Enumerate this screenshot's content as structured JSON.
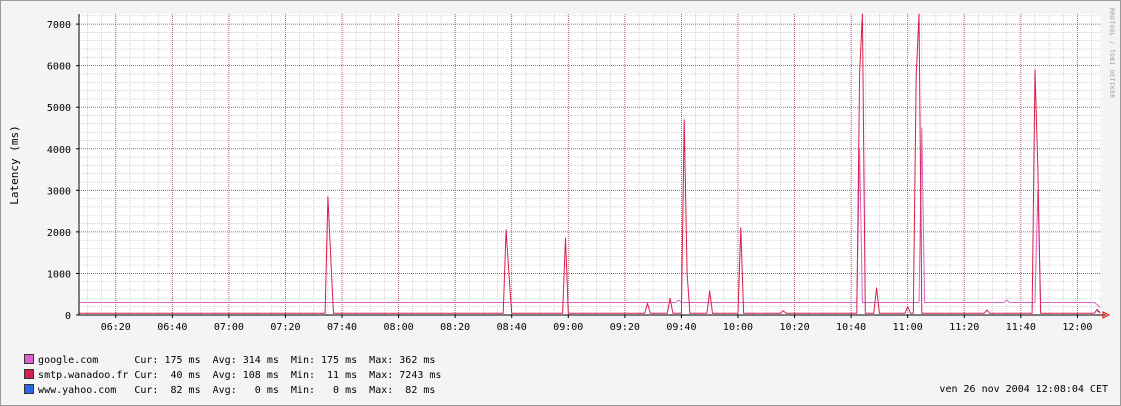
{
  "watermark": "RRDTOOL / TOBI OETIKER",
  "timestamp": "ven 26 nov 2004 12:08:04 CET",
  "colors": {
    "background": "#f4f4f4",
    "canvas": "#ffffff",
    "minor_grid": "#c7b2bd",
    "major_grid": "#b2385a",
    "arrow": "#ff0000"
  },
  "legend": [
    {
      "name": "google.com",
      "color": "#d964c6",
      "cur": "175 ms",
      "avg": "314 ms",
      "min": "175 ms",
      "max": "362 ms"
    },
    {
      "name": "smtp.wanadoo.fr",
      "color": "#d6204a",
      "cur": " 40 ms",
      "avg": "108 ms",
      "min": " 11 ms",
      "max": "7243 ms"
    },
    {
      "name": "www.yahoo.com",
      "color": "#2e64e6",
      "cur": " 82 ms",
      "avg": "  0 ms",
      "min": "  0 ms",
      "max": " 82 ms"
    }
  ],
  "legend_labels": {
    "cur": "Cur:",
    "avg": "Avg:",
    "min": "Min:",
    "max": "Max:"
  },
  "chart_data": {
    "type": "line",
    "title": "",
    "xlabel": "",
    "ylabel": "Latency (ms)",
    "ylim": [
      0,
      7243
    ],
    "xlim": [
      "06:07",
      "12:08"
    ],
    "grid": true,
    "legend_position": "bottom-left",
    "x_ticks": [
      "06:20",
      "06:40",
      "07:00",
      "07:20",
      "07:40",
      "08:00",
      "08:20",
      "08:40",
      "09:00",
      "09:20",
      "09:40",
      "10:00",
      "10:20",
      "10:40",
      "11:00",
      "11:20",
      "11:40",
      "12:00"
    ],
    "y_ticks": [
      0,
      1000,
      2000,
      3000,
      4000,
      5000,
      6000,
      7000
    ],
    "series": [
      {
        "name": "google.com",
        "color": "#d964c6",
        "points": [
          [
            "06:07",
            300
          ],
          [
            "09:38",
            300
          ],
          [
            "09:39",
            360
          ],
          [
            "09:40",
            300
          ],
          [
            "10:42",
            300
          ],
          [
            "10:43",
            4000
          ],
          [
            "10:44",
            300
          ],
          [
            "11:04",
            300
          ],
          [
            "11:05",
            4500
          ],
          [
            "11:06",
            300
          ],
          [
            "11:34",
            300
          ],
          [
            "11:35",
            360
          ],
          [
            "11:36",
            300
          ],
          [
            "11:45",
            300
          ],
          [
            "11:46",
            3000
          ],
          [
            "11:47",
            300
          ],
          [
            "12:06",
            300
          ],
          [
            "12:07",
            250
          ],
          [
            "12:08",
            175
          ]
        ]
      },
      {
        "name": "smtp.wanadoo.fr",
        "color": "#d6204a",
        "points": [
          [
            "06:07",
            40
          ],
          [
            "07:34",
            40
          ],
          [
            "07:35",
            2850
          ],
          [
            "07:36",
            1400
          ],
          [
            "07:37",
            40
          ],
          [
            "08:37",
            40
          ],
          [
            "08:38",
            2050
          ],
          [
            "08:39",
            1000
          ],
          [
            "08:40",
            40
          ],
          [
            "08:58",
            40
          ],
          [
            "08:59",
            1850
          ],
          [
            "09:00",
            40
          ],
          [
            "09:27",
            40
          ],
          [
            "09:28",
            280
          ],
          [
            "09:29",
            40
          ],
          [
            "09:35",
            40
          ],
          [
            "09:36",
            400
          ],
          [
            "09:37",
            40
          ],
          [
            "09:40",
            40
          ],
          [
            "09:41",
            4700
          ],
          [
            "09:42",
            1000
          ],
          [
            "09:43",
            40
          ],
          [
            "09:49",
            40
          ],
          [
            "09:50",
            580
          ],
          [
            "09:51",
            40
          ],
          [
            "10:00",
            40
          ],
          [
            "10:01",
            2100
          ],
          [
            "10:02",
            40
          ],
          [
            "10:15",
            40
          ],
          [
            "10:16",
            100
          ],
          [
            "10:17",
            40
          ],
          [
            "10:42",
            40
          ],
          [
            "10:43",
            5800
          ],
          [
            "10:44",
            7243
          ],
          [
            "10:45",
            40
          ],
          [
            "10:46",
            40
          ],
          [
            "10:47",
            40
          ],
          [
            "10:48",
            40
          ],
          [
            "10:49",
            650
          ],
          [
            "10:50",
            40
          ],
          [
            "10:59",
            40
          ],
          [
            "11:00",
            200
          ],
          [
            "11:01",
            40
          ],
          [
            "11:02",
            40
          ],
          [
            "11:03",
            5750
          ],
          [
            "11:04",
            7243
          ],
          [
            "11:05",
            40
          ],
          [
            "11:27",
            40
          ],
          [
            "11:28",
            120
          ],
          [
            "11:29",
            40
          ],
          [
            "11:44",
            40
          ],
          [
            "11:45",
            5900
          ],
          [
            "11:46",
            3600
          ],
          [
            "11:47",
            40
          ],
          [
            "12:06",
            40
          ],
          [
            "12:07",
            140
          ],
          [
            "12:08",
            40
          ]
        ]
      },
      {
        "name": "www.yahoo.com",
        "color": "#2e64e6",
        "points": [
          [
            "12:07",
            82
          ],
          [
            "12:08",
            82
          ]
        ]
      }
    ]
  }
}
